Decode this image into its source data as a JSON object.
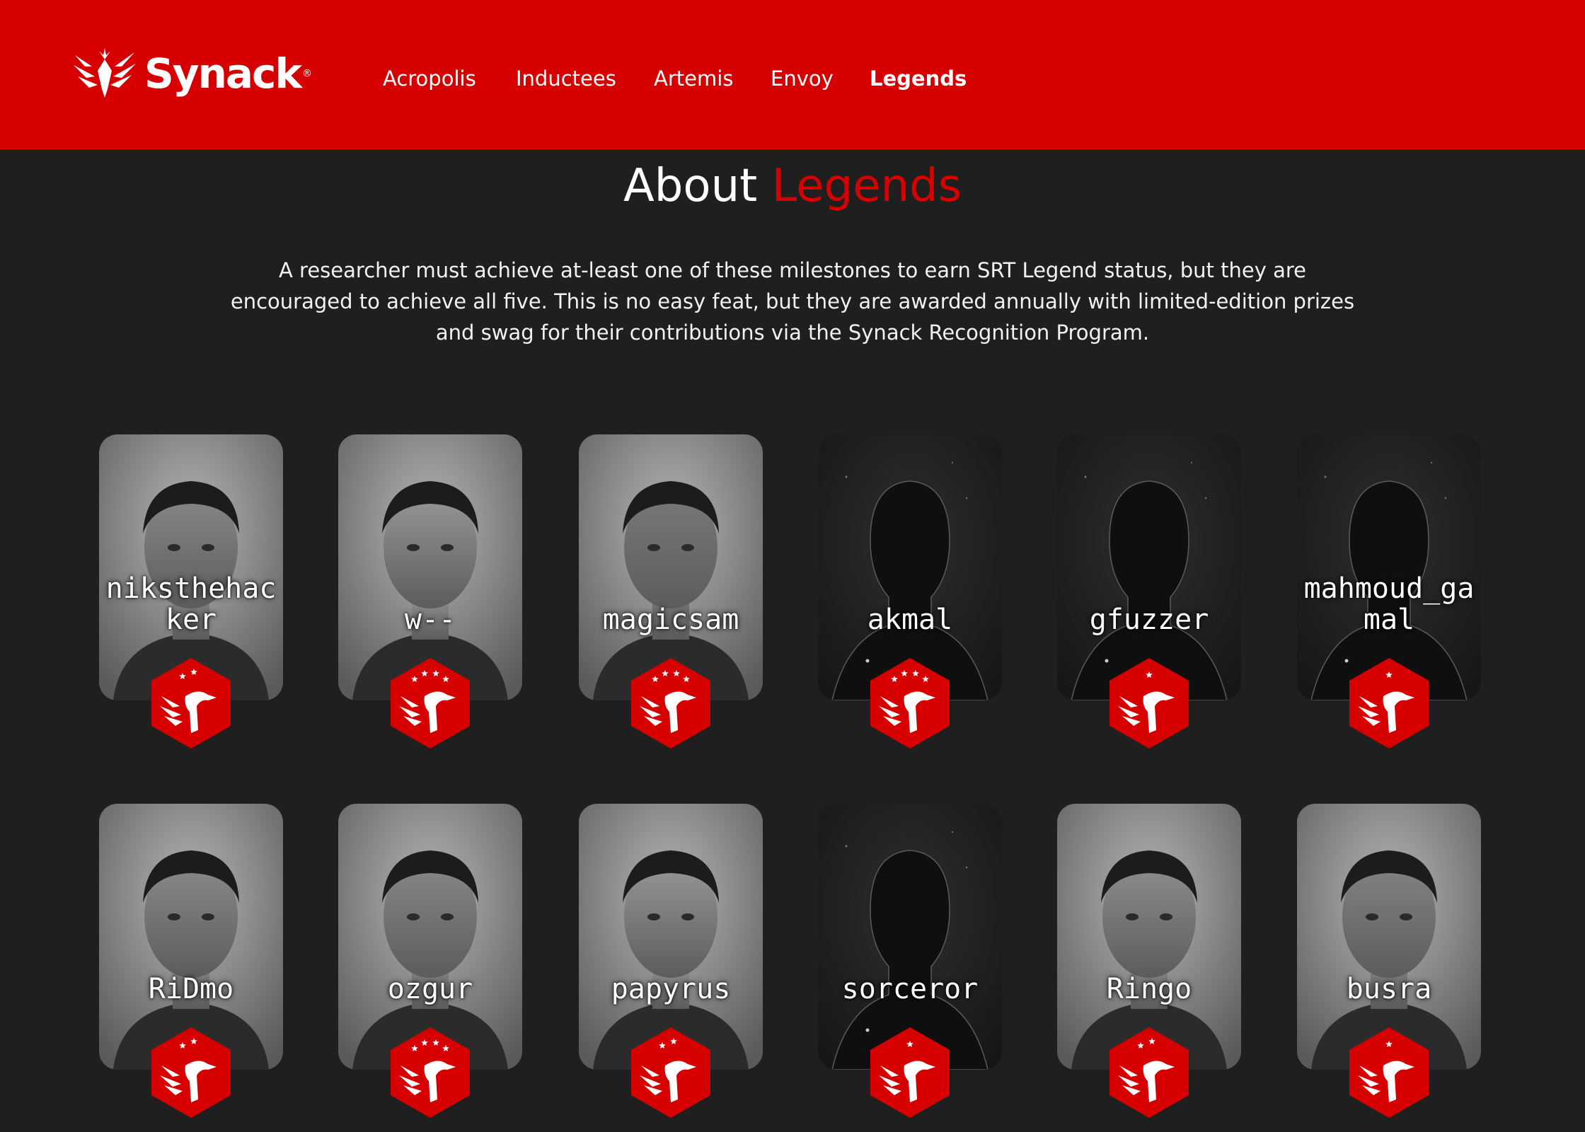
{
  "header": {
    "brand": "Synack",
    "nav": [
      {
        "label": "Acropolis",
        "active": false
      },
      {
        "label": "Inductees",
        "active": false
      },
      {
        "label": "Artemis",
        "active": false
      },
      {
        "label": "Envoy",
        "active": false
      },
      {
        "label": "Legends",
        "active": true
      }
    ]
  },
  "about": {
    "title_plain": "About",
    "title_accent": "Legends",
    "paragraph_lines": [
      "A researcher must achieve at-least one of these milestones to earn SRT Legend status, but they are",
      "encouraged to achieve all five. This is no easy feat, but they are awarded annually with limited-edition prizes",
      "and swag for their contributions via the Synack Recognition Program."
    ]
  },
  "colors": {
    "brand_red": "#d70000",
    "background": "#1f1f1f"
  },
  "legends": [
    {
      "name": "niksthehac ker",
      "stars": 2,
      "photo": "portrait"
    },
    {
      "name": "w--",
      "stars": 4,
      "photo": "portrait"
    },
    {
      "name": "magicsam",
      "stars": 4,
      "photo": "portrait"
    },
    {
      "name": "akmal",
      "stars": 4,
      "photo": "silhouette"
    },
    {
      "name": "gfuzzer",
      "stars": 1,
      "photo": "silhouette"
    },
    {
      "name": "mahmoud_ga mal",
      "stars": 1,
      "photo": "silhouette"
    },
    {
      "name": "RiDmo",
      "stars": 2,
      "photo": "portrait"
    },
    {
      "name": "ozgur",
      "stars": 4,
      "photo": "portrait"
    },
    {
      "name": "papyrus",
      "stars": 2,
      "photo": "portrait"
    },
    {
      "name": "sorceror",
      "stars": 1,
      "photo": "silhouette"
    },
    {
      "name": "Ringo",
      "stars": 2,
      "photo": "portrait"
    },
    {
      "name": "busra",
      "stars": 1,
      "photo": "portrait"
    }
  ]
}
